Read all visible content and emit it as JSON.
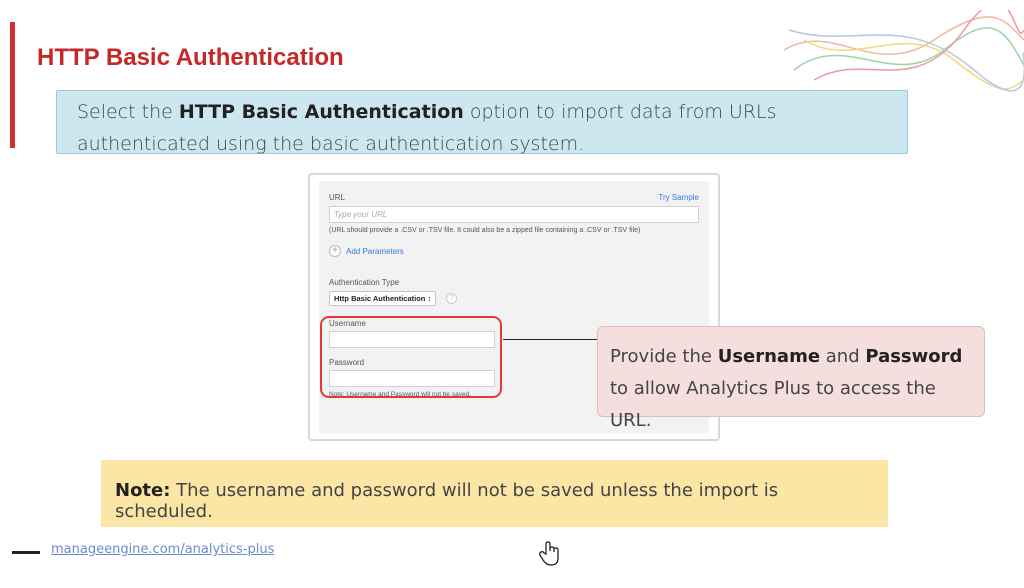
{
  "slide": {
    "title": "HTTP Basic Authentication",
    "intro": {
      "prefix": "Select the ",
      "bold": "HTTP Basic Authentication",
      "suffix": " option to import data from URLs authenticated using the basic authentication system."
    },
    "callout": {
      "part1": "Provide the ",
      "bold1": "Username",
      "part2": " and ",
      "bold2": "Password",
      "part3": " to allow Analytics Plus to access the URL."
    },
    "note": {
      "label": "Note:",
      "text": " The username and password will not be saved unless the import is scheduled."
    },
    "footer_link": "manageengine.com/analytics-plus"
  },
  "form": {
    "url_label": "URL",
    "try_sample": "Try Sample",
    "url_placeholder": "Type your URL",
    "url_hint": "(URL should provide a .CSV or .TSV file. It could also be a zipped file containing a .CSV or .TSV file)",
    "add_parameters": "Add Parameters",
    "auth_type_label": "Authentication Type",
    "auth_type_value": "Http Basic Authentication ↕",
    "username_label": "Username",
    "password_label": "Password",
    "save_note": "Note: Username and Password will not be saved."
  },
  "colors": {
    "title_red": "#c62828",
    "highlight_red": "#e53935",
    "info_blue": "#cde7f0",
    "callout_pink": "#f4dede",
    "note_yellow": "#fbe6a6",
    "link_blue": "#3b7bd6"
  },
  "icons": {
    "add": "plus-circle-icon",
    "help": "question-circle-icon",
    "cursor": "hand-pointer-icon"
  }
}
